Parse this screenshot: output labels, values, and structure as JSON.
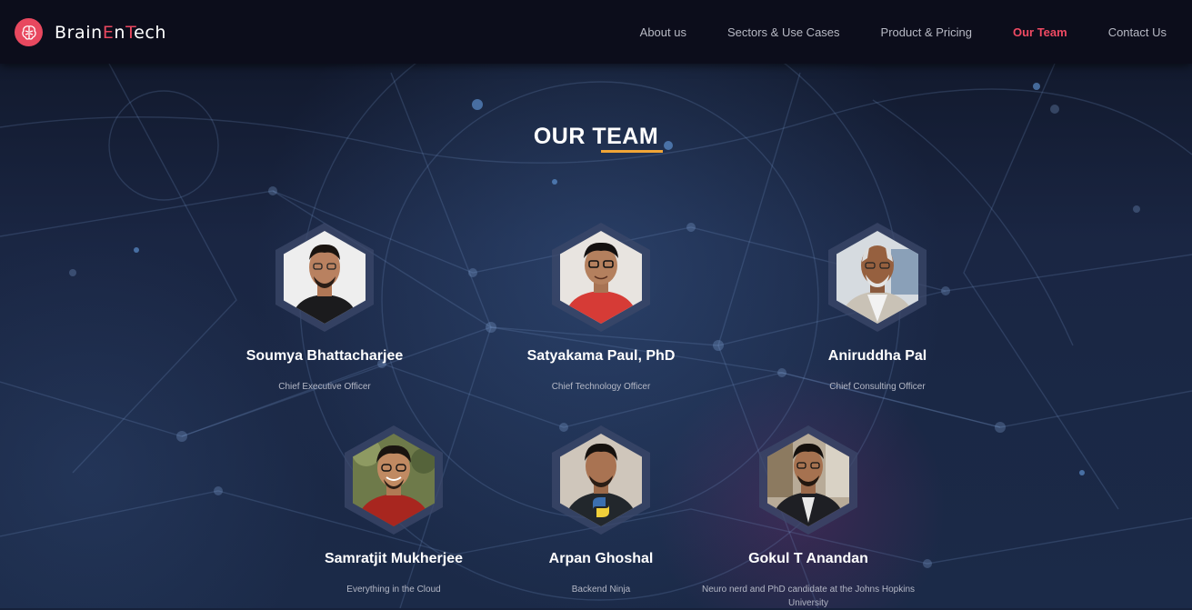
{
  "brand": {
    "name_parts": [
      "Brain",
      "E",
      "n",
      "T",
      "ech"
    ],
    "accent_color": "#e8485f",
    "icon": "brain-icon"
  },
  "nav": {
    "items": [
      {
        "label": "About us",
        "active": false
      },
      {
        "label": "Sectors & Use Cases",
        "active": false
      },
      {
        "label": "Product & Pricing",
        "active": false
      },
      {
        "label": "Our Team",
        "active": true
      },
      {
        "label": "Contact Us",
        "active": false
      }
    ]
  },
  "section": {
    "title": "OUR TEAM",
    "underline_color": "#f0a537"
  },
  "team": [
    {
      "name": "Soumya Bhattacharjee",
      "role": "Chief Executive Officer"
    },
    {
      "name": "Satyakama Paul, PhD",
      "role": "Chief Technology Officer"
    },
    {
      "name": "Aniruddha Pal",
      "role": "Chief Consulting Officer"
    },
    {
      "name": "Samratjit Mukherjee",
      "role": "Everything in the Cloud"
    },
    {
      "name": "Arpan Ghoshal",
      "role": "Backend Ninja"
    },
    {
      "name": "Gokul T Anandan",
      "role": "Neuro nerd and PhD candidate at the Johns Hopkins University"
    }
  ]
}
